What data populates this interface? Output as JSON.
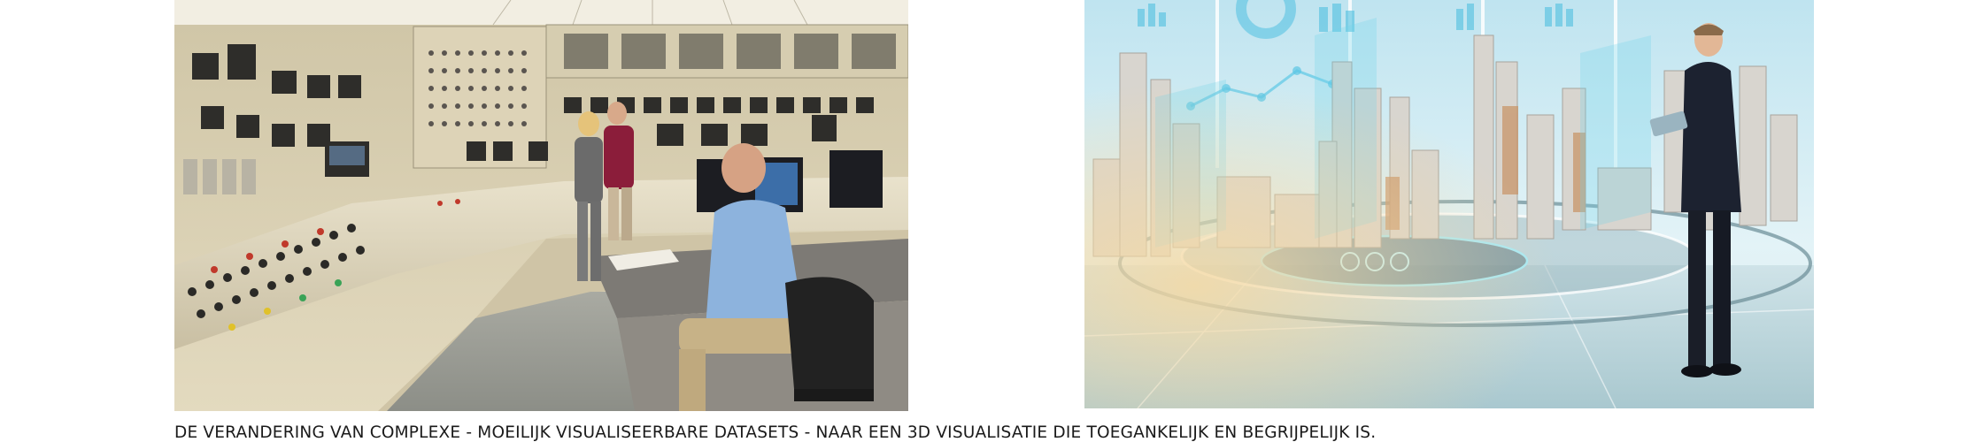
{
  "caption": "DE VERANDERING VAN COMPLEXE - MOEILIJK VISUALISEERBARE DATASETS - NAAR EEN 3D VISUALISATIE DIE TOEGANKELIJK EN BEGRIJPELIJK IS.",
  "images": {
    "left": {
      "subject": "control-room-photo"
    },
    "right": {
      "subject": "3d-city-visualisation-photo"
    }
  },
  "colors": {
    "panel_beige": "#d9cfb2",
    "floor_grey": "#9a9c95",
    "holo_cyan": "#6fd3e8",
    "sky_light": "#cfeaf3"
  }
}
